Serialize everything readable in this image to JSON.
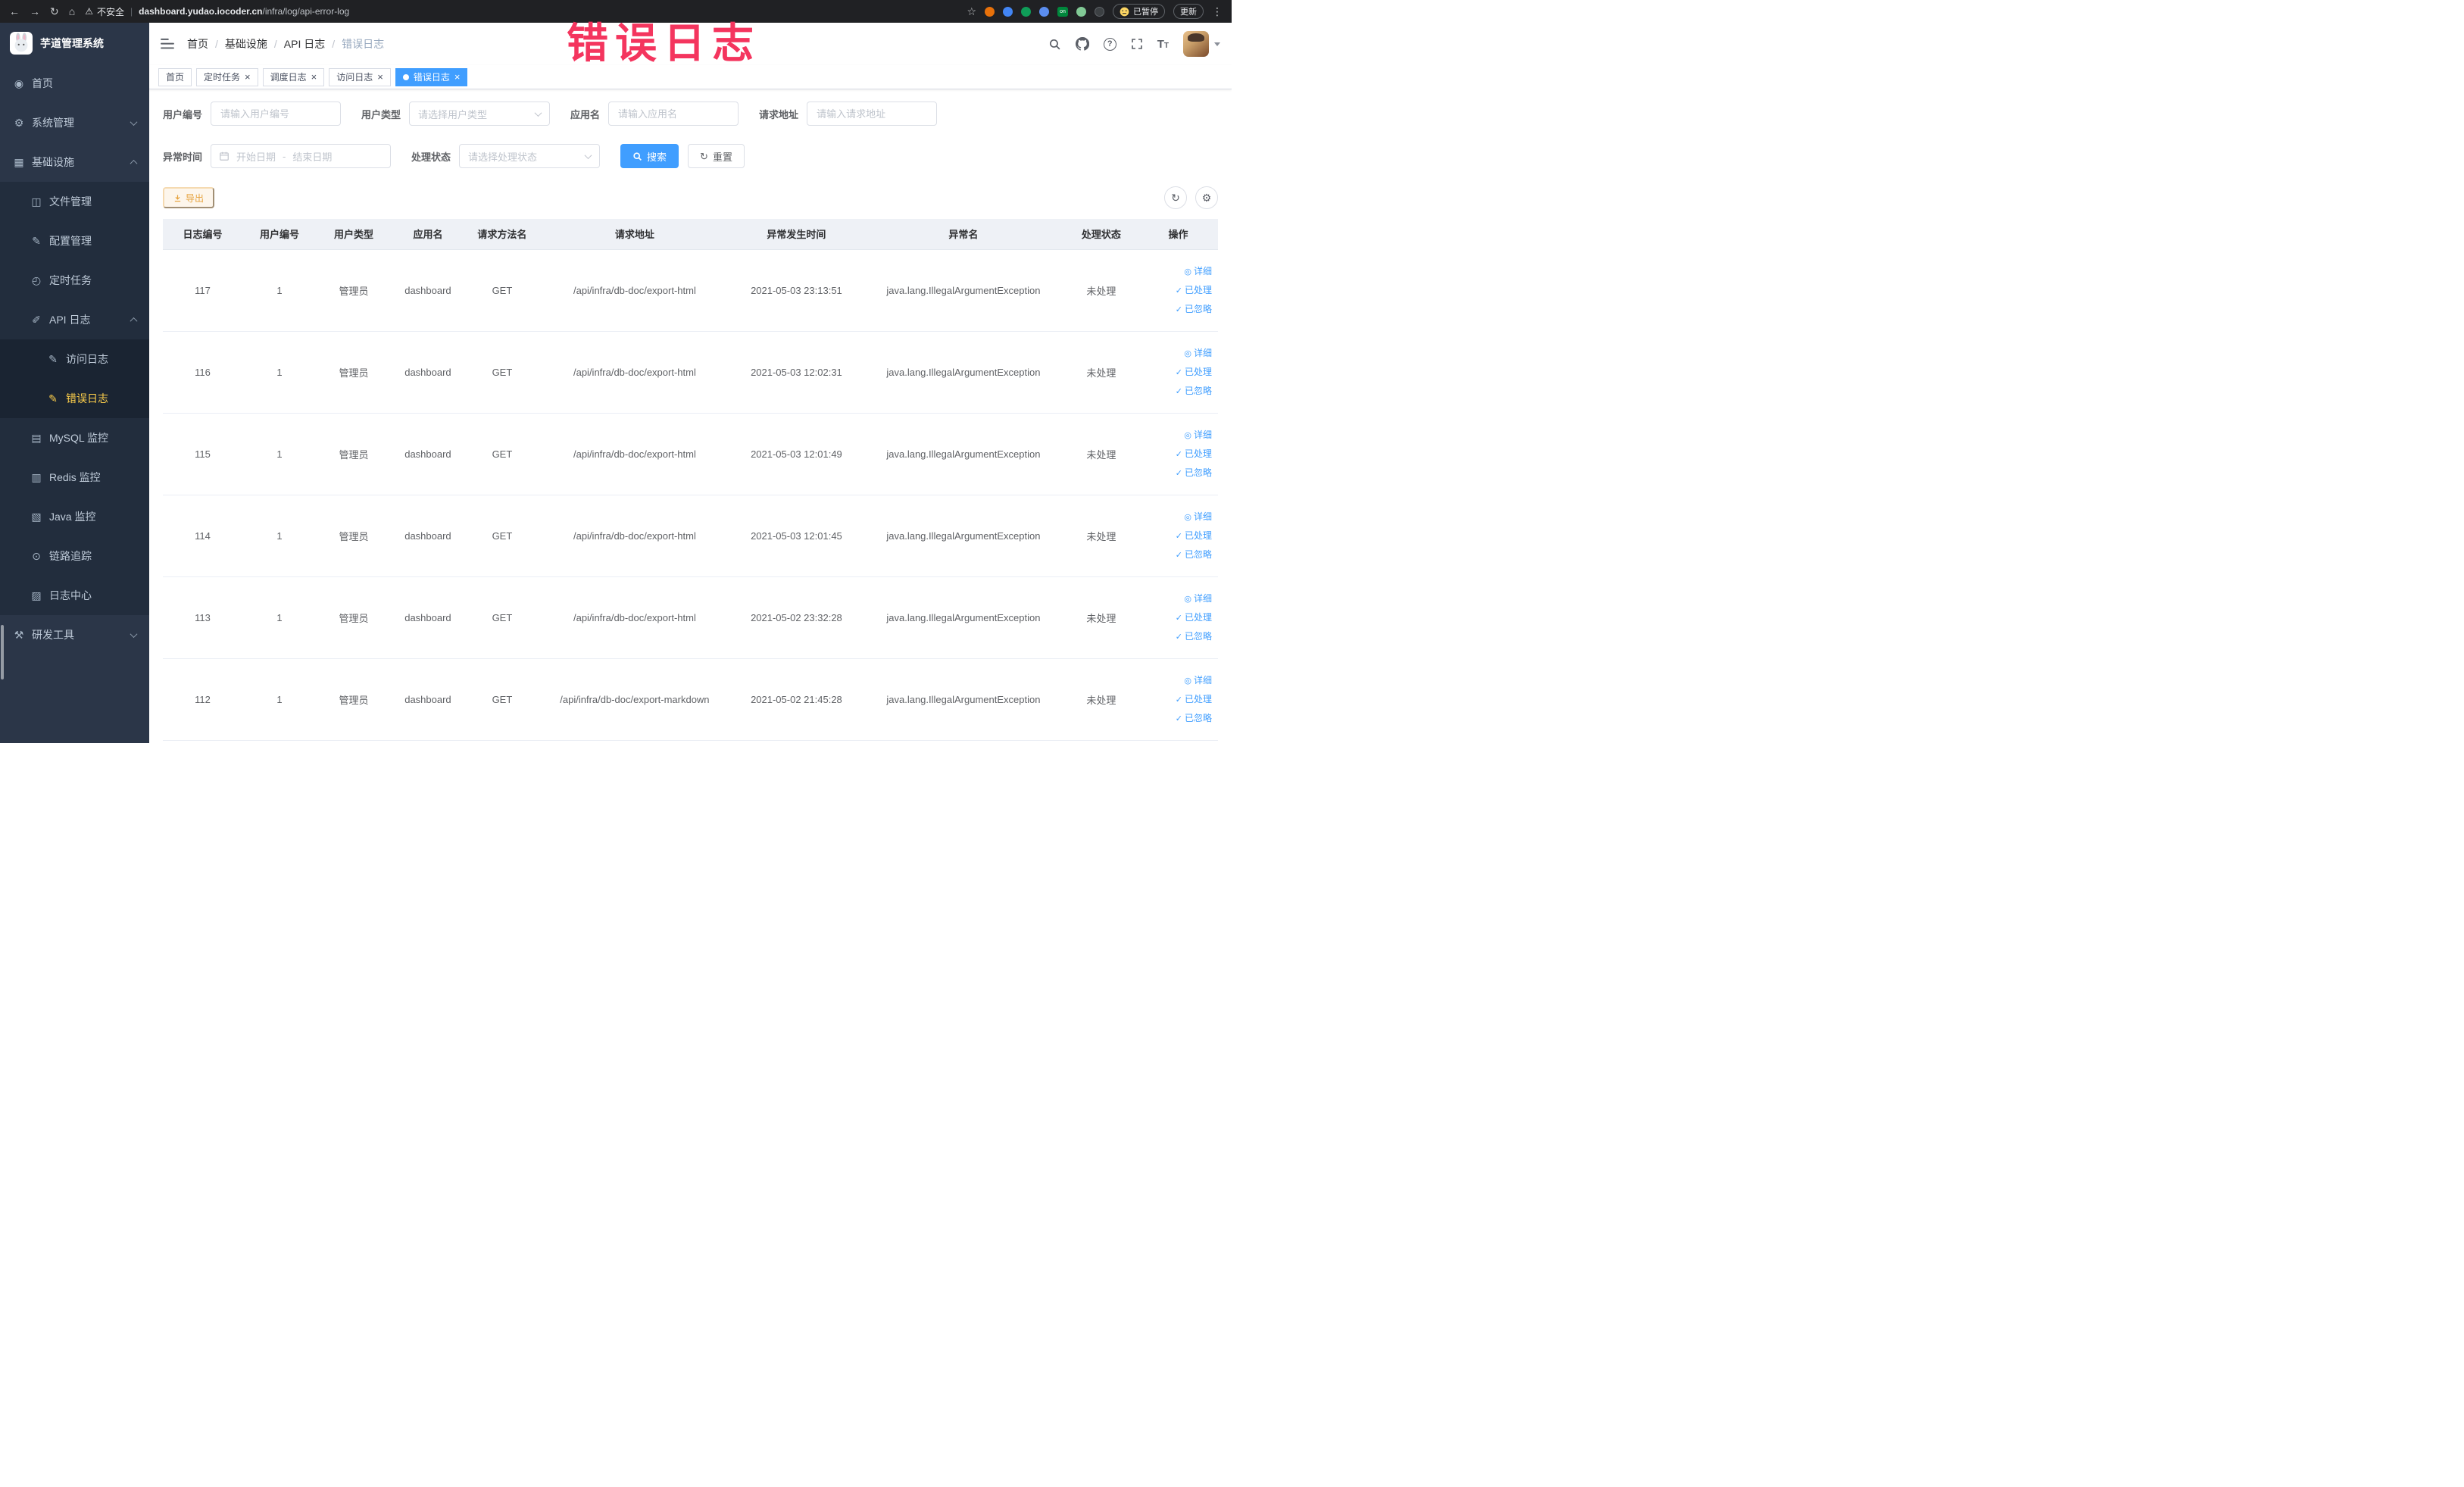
{
  "colors": {
    "accent": "#409eff",
    "sidebar_active": "#ffd04b",
    "warning": "#e6a23c",
    "annotation": "#f4355e"
  },
  "icons": {
    "back": "←",
    "forward": "→",
    "reload": "↻",
    "home": "⌂",
    "warning": "⚠",
    "star": "☆",
    "more": "⋮",
    "dashboard": "◉",
    "system": "⚙",
    "infra": "▦",
    "file": "◫",
    "config": "✎",
    "job": "◴",
    "apilog": "✐",
    "accesslog": "✎",
    "errorlog": "✎",
    "mysql": "▤",
    "redis": "▥",
    "java": "▧",
    "trace": "⊙",
    "logcenter": "▨",
    "tools": "⚒",
    "refresh": "↻",
    "settings": "⚙",
    "reset": "↻",
    "eye": "◎",
    "check": "✓",
    "close": "×"
  },
  "browser": {
    "security_label": "不安全",
    "url_domain": "dashboard.yudao.iocoder.cn",
    "url_path": "/infra/log/api-error-log",
    "paused_badge": "已暂停",
    "update_button": "更新"
  },
  "annotation": {
    "text": "错误日志"
  },
  "sidebar": {
    "logo_title": "芋道管理系统",
    "items": [
      {
        "label": "首页"
      },
      {
        "label": "系统管理"
      },
      {
        "label": "基础设施"
      },
      {
        "label": "文件管理"
      },
      {
        "label": "配置管理"
      },
      {
        "label": "定时任务"
      },
      {
        "label": "API 日志"
      },
      {
        "label": "访问日志"
      },
      {
        "label": "错误日志"
      },
      {
        "label": "MySQL 监控"
      },
      {
        "label": "Redis 监控"
      },
      {
        "label": "Java 监控"
      },
      {
        "label": "链路追踪"
      },
      {
        "label": "日志中心"
      },
      {
        "label": "研发工具"
      }
    ]
  },
  "header": {
    "breadcrumb": [
      "首页",
      "基础设施",
      "API 日志",
      "错误日志"
    ]
  },
  "tabs": [
    {
      "label": "首页",
      "closable": false,
      "active": false
    },
    {
      "label": "定时任务",
      "closable": true,
      "active": false
    },
    {
      "label": "调度日志",
      "closable": true,
      "active": false
    },
    {
      "label": "访问日志",
      "closable": true,
      "active": false
    },
    {
      "label": "错误日志",
      "closable": true,
      "active": true
    }
  ],
  "filters": {
    "user_id_label": "用户编号",
    "user_id_placeholder": "请输入用户编号",
    "user_type_label": "用户类型",
    "user_type_placeholder": "请选择用户类型",
    "app_name_label": "应用名",
    "app_name_placeholder": "请输入应用名",
    "request_url_label": "请求地址",
    "request_url_placeholder": "请输入请求地址",
    "exception_time_label": "异常时间",
    "start_placeholder": "开始日期",
    "range_separator": "-",
    "end_placeholder": "结束日期",
    "process_status_label": "处理状态",
    "process_status_placeholder": "请选择处理状态",
    "search_button": "搜索",
    "reset_button": "重置"
  },
  "toolbar": {
    "export_button": "导出"
  },
  "table": {
    "columns": [
      "日志编号",
      "用户编号",
      "用户类型",
      "应用名",
      "请求方法名",
      "请求地址",
      "异常发生时间",
      "异常名",
      "处理状态",
      "操作"
    ],
    "actions": [
      "详细",
      "已处理",
      "已忽略"
    ],
    "rows": [
      {
        "id": "117",
        "user_id": "1",
        "user_type": "管理员",
        "app": "dashboard",
        "method": "GET",
        "url": "/api/infra/db-doc/export-html",
        "time": "2021-05-03 23:13:51",
        "exception": "java.lang.IllegalArgumentException",
        "status": "未处理"
      },
      {
        "id": "116",
        "user_id": "1",
        "user_type": "管理员",
        "app": "dashboard",
        "method": "GET",
        "url": "/api/infra/db-doc/export-html",
        "time": "2021-05-03 12:02:31",
        "exception": "java.lang.IllegalArgumentException",
        "status": "未处理"
      },
      {
        "id": "115",
        "user_id": "1",
        "user_type": "管理员",
        "app": "dashboard",
        "method": "GET",
        "url": "/api/infra/db-doc/export-html",
        "time": "2021-05-03 12:01:49",
        "exception": "java.lang.IllegalArgumentException",
        "status": "未处理"
      },
      {
        "id": "114",
        "user_id": "1",
        "user_type": "管理员",
        "app": "dashboard",
        "method": "GET",
        "url": "/api/infra/db-doc/export-html",
        "time": "2021-05-03 12:01:45",
        "exception": "java.lang.IllegalArgumentException",
        "status": "未处理"
      },
      {
        "id": "113",
        "user_id": "1",
        "user_type": "管理员",
        "app": "dashboard",
        "method": "GET",
        "url": "/api/infra/db-doc/export-html",
        "time": "2021-05-02 23:32:28",
        "exception": "java.lang.IllegalArgumentException",
        "status": "未处理"
      },
      {
        "id": "112",
        "user_id": "1",
        "user_type": "管理员",
        "app": "dashboard",
        "method": "GET",
        "url": "/api/infra/db-doc/export-markdown",
        "time": "2021-05-02 21:45:28",
        "exception": "java.lang.IllegalArgumentException",
        "status": "未处理"
      }
    ]
  }
}
